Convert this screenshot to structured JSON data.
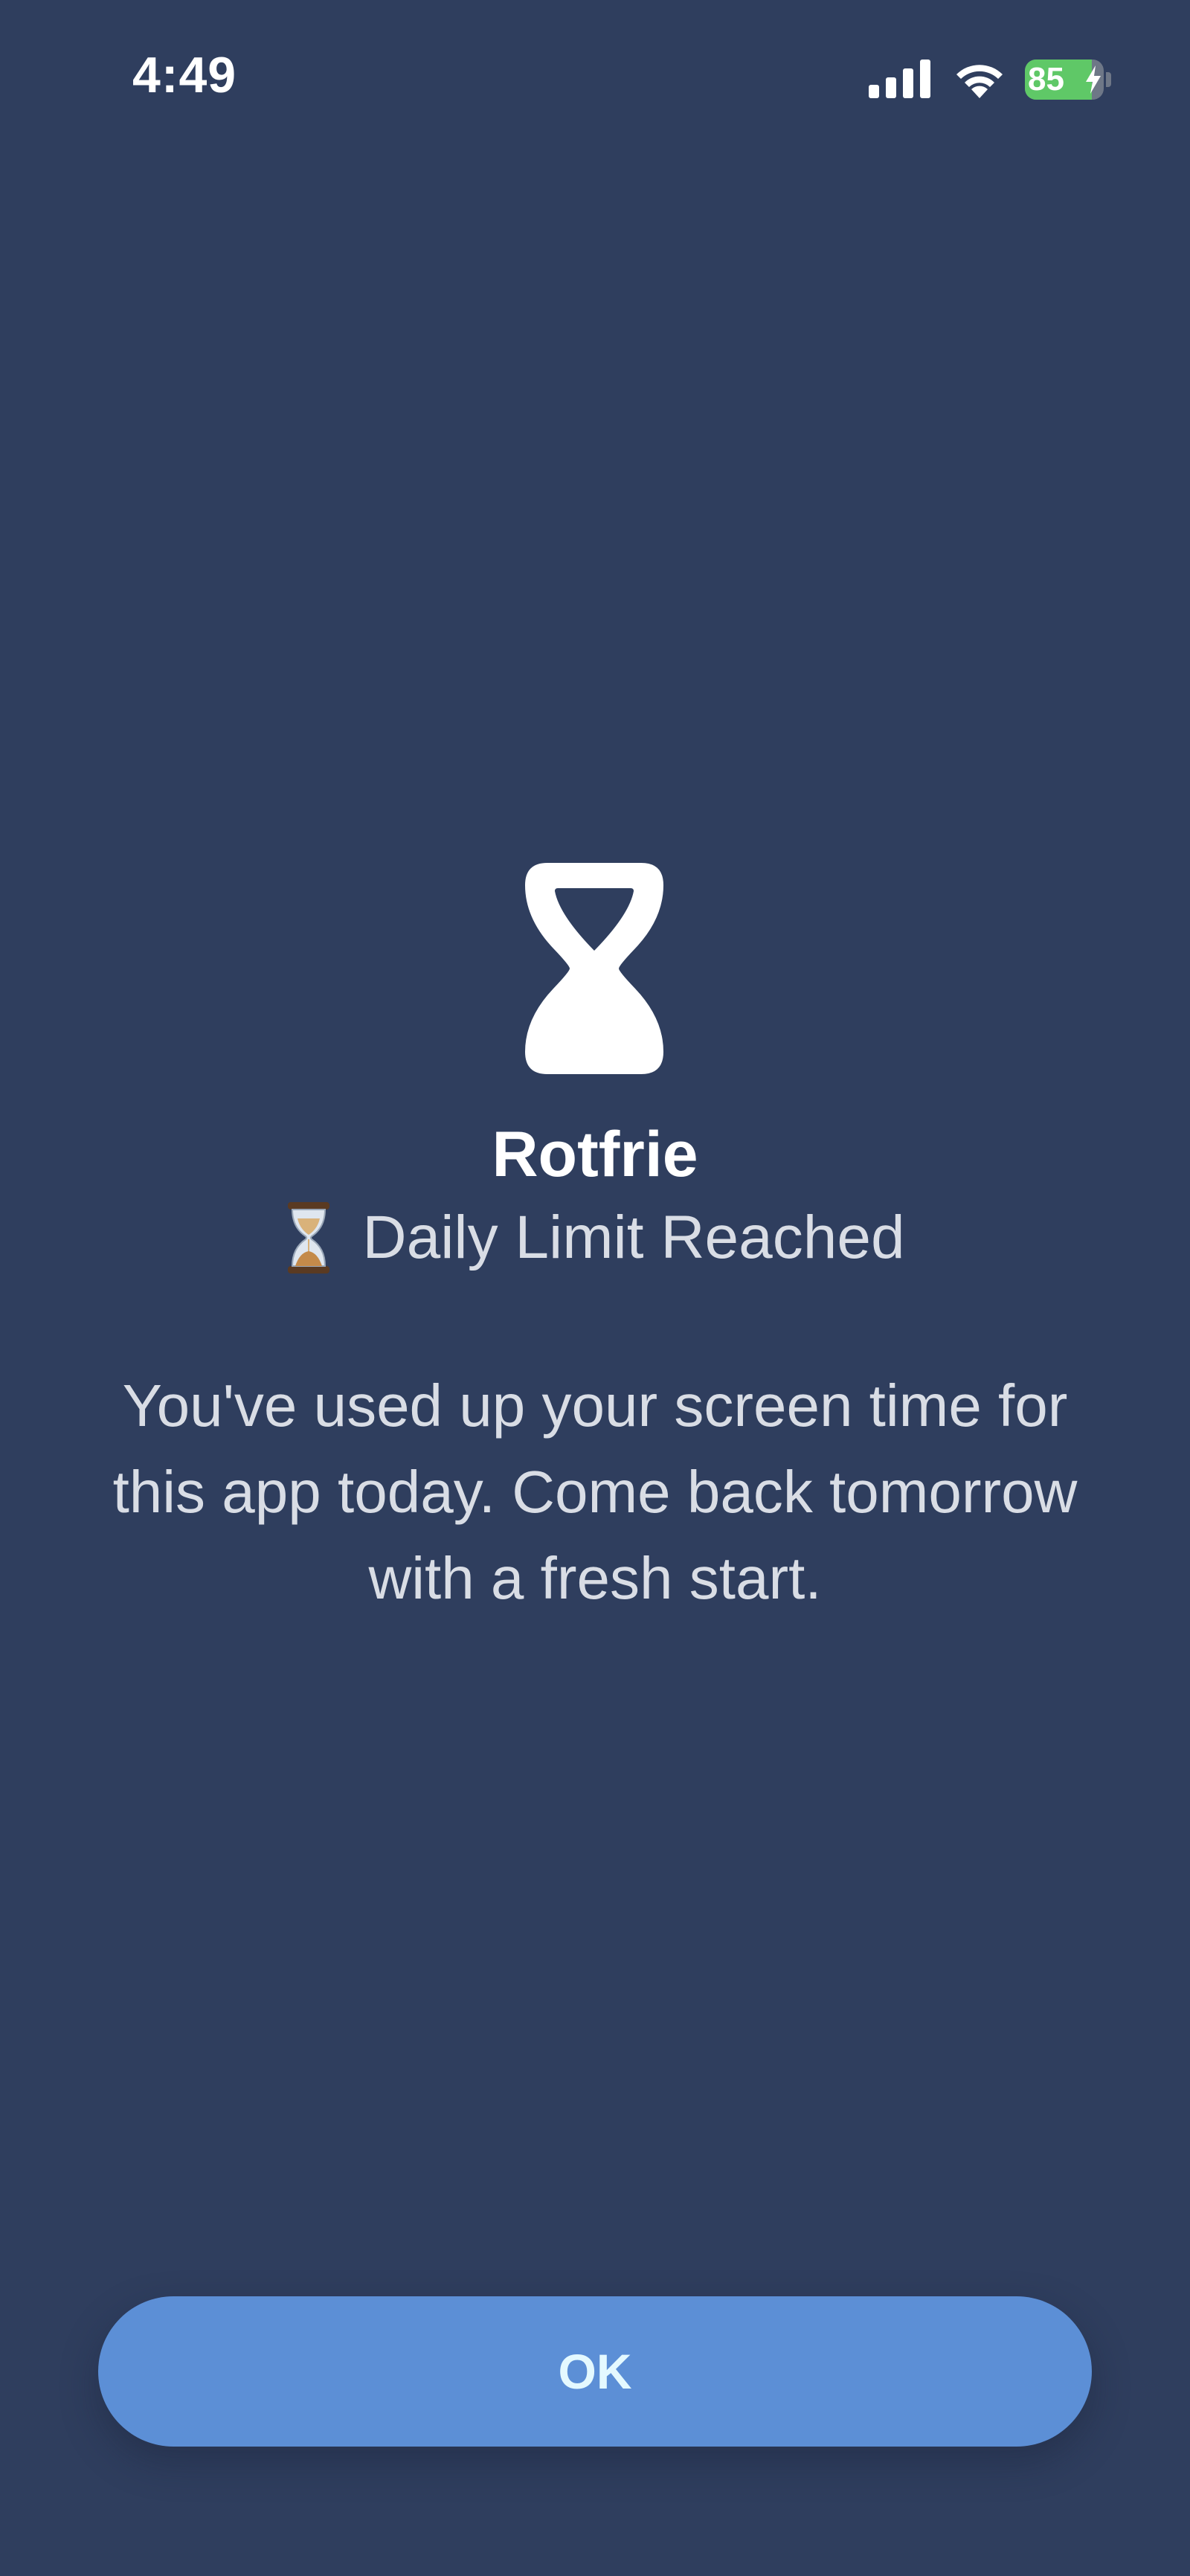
{
  "status_bar": {
    "time": "4:49",
    "battery_percent": "85",
    "battery_level": 0.85,
    "icons": [
      "cellular-signal-icon",
      "wifi-icon",
      "battery-charging-icon"
    ]
  },
  "screen": {
    "icon": "hourglass-icon",
    "app_name": "Rotfrie",
    "subtitle_emoji": "hourglass-emoji-icon",
    "subtitle": "Daily Limit Reached",
    "message": "You've used up your screen time for this app today. Come back tomorrow with a fresh start.",
    "ok_label": "OK"
  },
  "colors": {
    "background": "#2f3e5e",
    "button": "#5c8fd6",
    "button_text": "#e4f9ff",
    "battery_fill": "#5fc867"
  }
}
